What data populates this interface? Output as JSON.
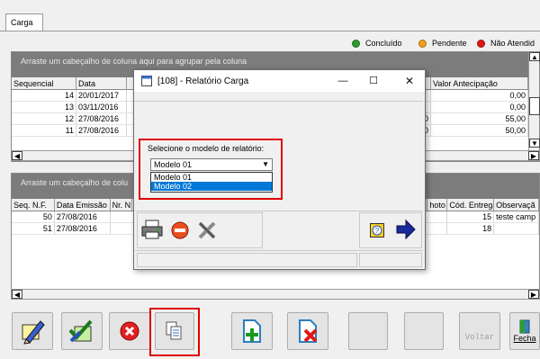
{
  "tab": {
    "label": "Carga"
  },
  "legend": {
    "concluido": "Concluído",
    "pendente": "Pendente",
    "nao_atendido": "Não Atendid",
    "colors": {
      "concluido": "#2f9a2f",
      "pendente": "#f0a020",
      "nao_atendido": "#e01818"
    }
  },
  "grid1": {
    "group_hint": "Arraste um cabeçalho de coluna aqui para agrupar pela coluna",
    "columns": [
      "Sequencial",
      "Data",
      "Valor Antecipação"
    ],
    "rows": [
      {
        "seq": "14",
        "data": "20/01/2017",
        "mid": "",
        "valor": "0,00"
      },
      {
        "seq": "13",
        "data": "03/11/2016",
        "mid": "",
        "valor": "0,00"
      },
      {
        "seq": "12",
        "data": "27/08/2016",
        "mid": "150",
        "valor": "55,00"
      },
      {
        "seq": "11",
        "data": "27/08/2016",
        "mid": "200",
        "valor": "50,00"
      }
    ]
  },
  "grid2": {
    "group_hint": "Arraste um cabeçalho de colu",
    "columns": [
      "Seq. N.F.",
      "Data Emissão",
      "Nr. N",
      "hoto",
      "Cód. Entrega",
      "Observaçã"
    ],
    "rows": [
      {
        "seq": "50",
        "data": "27/08/2016",
        "cod": "15",
        "obs": "teste camp"
      },
      {
        "seq": "51",
        "data": "27/08/2016",
        "cod": "18",
        "obs": ""
      }
    ]
  },
  "dialog": {
    "title": "[108] - Relatório Carga",
    "select_label": "Selecione o modelo de relatório:",
    "selected_value": "Modelo 01",
    "options": [
      "Modelo 01",
      "Modelo 02"
    ],
    "highlighted_option": "Modelo 02"
  },
  "toolbar": {
    "voltar": "Voltar",
    "fechar": "Fecha"
  }
}
